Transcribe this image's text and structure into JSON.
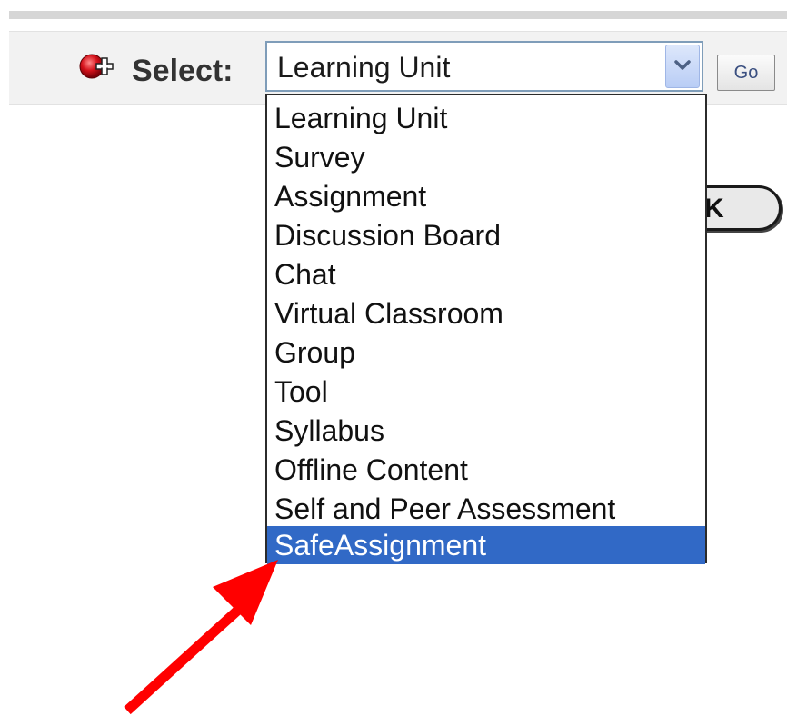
{
  "toolbar": {
    "add_icon": "red-plus-circle-icon",
    "select_label": "Select:",
    "select_value": "Learning Unit",
    "go_label": "Go",
    "accent_color": "#3169c6"
  },
  "dropdown": {
    "options": [
      "Learning Unit",
      "Survey",
      "Assignment",
      "Discussion Board",
      "Chat",
      "Virtual Classroom",
      "Group",
      "Tool",
      "Syllabus",
      "Offline Content",
      "Self and Peer Assessment",
      "SafeAssignment"
    ],
    "highlighted": "SafeAssignment"
  },
  "background_button": {
    "partial_label": "K"
  },
  "annotation": {
    "arrow_icon": "red-arrow-pointer",
    "arrow_color": "#ff0000"
  }
}
